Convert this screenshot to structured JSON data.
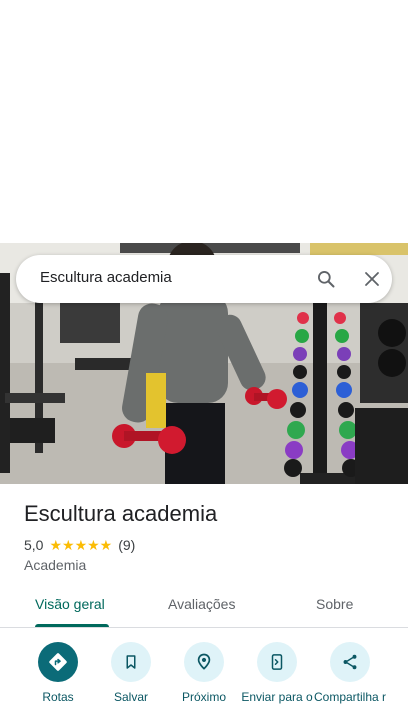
{
  "search": {
    "query": "Escultura academia"
  },
  "place": {
    "title": "Escultura academia",
    "rating": "5,0",
    "stars": "★★★★★",
    "review_count": "(9)",
    "category": "Academia"
  },
  "tabs": [
    {
      "label": "Visão geral",
      "active": true
    },
    {
      "label": "Avaliações",
      "active": false
    },
    {
      "label": "Sobre",
      "active": false
    }
  ],
  "actions": [
    {
      "label": "Rotas",
      "icon": "directions-icon"
    },
    {
      "label": "Salvar",
      "icon": "bookmark-icon"
    },
    {
      "label": "Próximo",
      "icon": "nearby-icon"
    },
    {
      "label": "Enviar para o",
      "icon": "send-to-phone-icon"
    },
    {
      "label": "Compartilha r",
      "icon": "share-icon"
    }
  ],
  "colors": {
    "accent": "#00695c",
    "action_primary": "#0b6b78",
    "action_secondary": "#dff3f8",
    "star": "#fbbc04"
  }
}
